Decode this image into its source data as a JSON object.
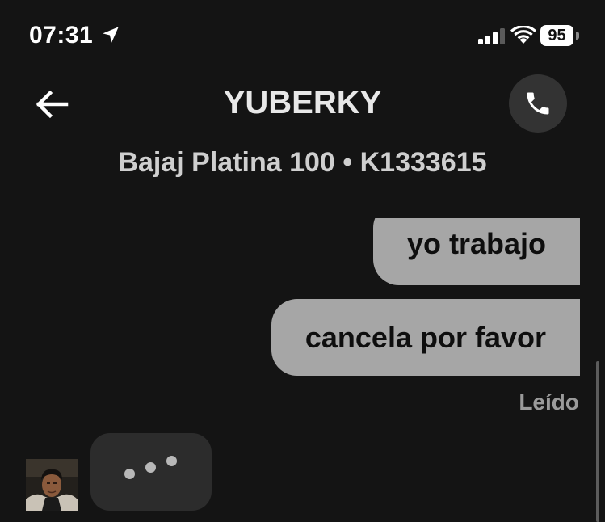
{
  "status_bar": {
    "time": "07:31",
    "battery": "95"
  },
  "header": {
    "title": "YUBERKY",
    "subtitle": "Bajaj Platina 100 • K1333615"
  },
  "messages": [
    {
      "text": "yo trabajo"
    },
    {
      "text": "cancela por favor"
    }
  ],
  "read_receipt": "Leído",
  "icons": {
    "back": "back-arrow-icon",
    "call": "phone-icon",
    "location": "location-arrow-icon",
    "signal": "cellular-signal-icon",
    "wifi": "wifi-icon"
  },
  "colors": {
    "background": "#141414",
    "outgoing_bubble": "#a6a6a6",
    "typing_bubble": "#2c2c2c",
    "call_button": "#333333"
  }
}
